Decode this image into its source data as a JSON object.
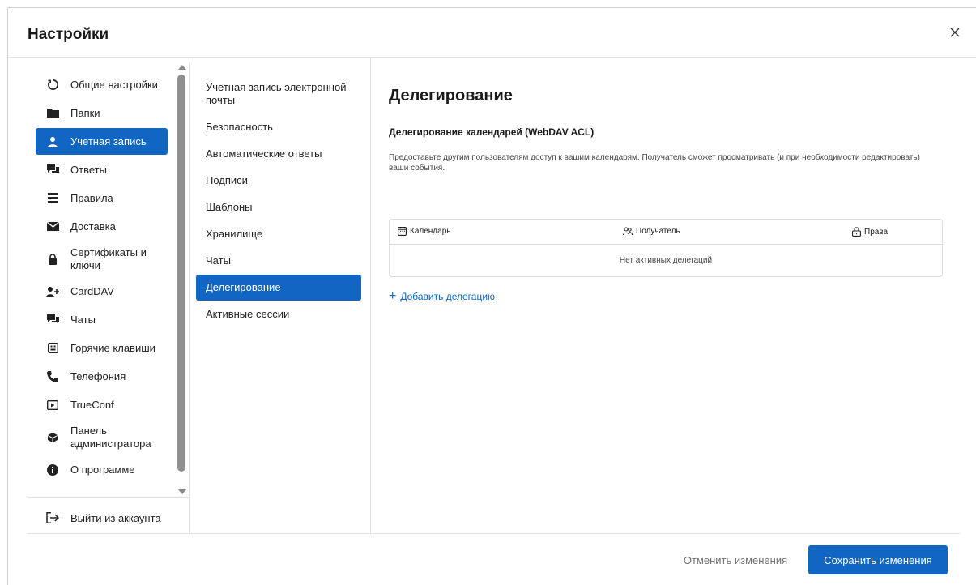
{
  "dialog": {
    "title": "Настройки",
    "close_icon": "close-icon"
  },
  "sidebar": {
    "items": [
      {
        "label": "Общие настройки",
        "icon": "general-settings-icon"
      },
      {
        "label": "Папки",
        "icon": "folder-icon"
      },
      {
        "label": "Учетная запись",
        "icon": "user-icon",
        "active": true
      },
      {
        "label": "Ответы",
        "icon": "replies-icon"
      },
      {
        "label": "Правила",
        "icon": "rules-icon"
      },
      {
        "label": "Доставка",
        "icon": "envelope-icon"
      },
      {
        "label": "Сертификаты и ключи",
        "icon": "lock-icon"
      },
      {
        "label": "CardDAV",
        "icon": "add-user-icon"
      },
      {
        "label": "Чаты",
        "icon": "chat-icon"
      },
      {
        "label": "Горячие клавиши",
        "icon": "keyboard-icon"
      },
      {
        "label": "Телефония",
        "icon": "phone-icon"
      },
      {
        "label": "TrueConf",
        "icon": "video-icon"
      },
      {
        "label": "Панель администратора",
        "icon": "admin-icon"
      },
      {
        "label": "О программе",
        "icon": "info-icon"
      }
    ],
    "logout_label": "Выйти из аккаунта"
  },
  "account_menu": {
    "items": [
      {
        "label": "Учетная запись электронной почты"
      },
      {
        "label": "Безопасность"
      },
      {
        "label": "Автоматические ответы"
      },
      {
        "label": "Подписи"
      },
      {
        "label": "Шаблоны"
      },
      {
        "label": "Хранилище"
      },
      {
        "label": "Чаты"
      },
      {
        "label": "Делегирование",
        "active": true
      },
      {
        "label": "Активные сессии"
      }
    ]
  },
  "content": {
    "title": "Делегирование",
    "section_title": "Делегирование календарей (WebDAV ACL)",
    "description": "Предоставьте другим пользователям доступ к вашим календарям. Получатель сможет просматривать (и при необходимости редактировать) ваши события.",
    "table": {
      "columns": [
        {
          "label": "Календарь",
          "icon": "calendar-icon"
        },
        {
          "label": "Получатель",
          "icon": "users-icon"
        },
        {
          "label": "Права",
          "icon": "lock-icon"
        }
      ],
      "empty_text": "Нет активных делегаций"
    },
    "add_label": "Добавить делегацию"
  },
  "footer": {
    "cancel_label": "Отменить изменения",
    "save_label": "Сохранить изменения"
  },
  "colors": {
    "accent": "#1066c2"
  }
}
